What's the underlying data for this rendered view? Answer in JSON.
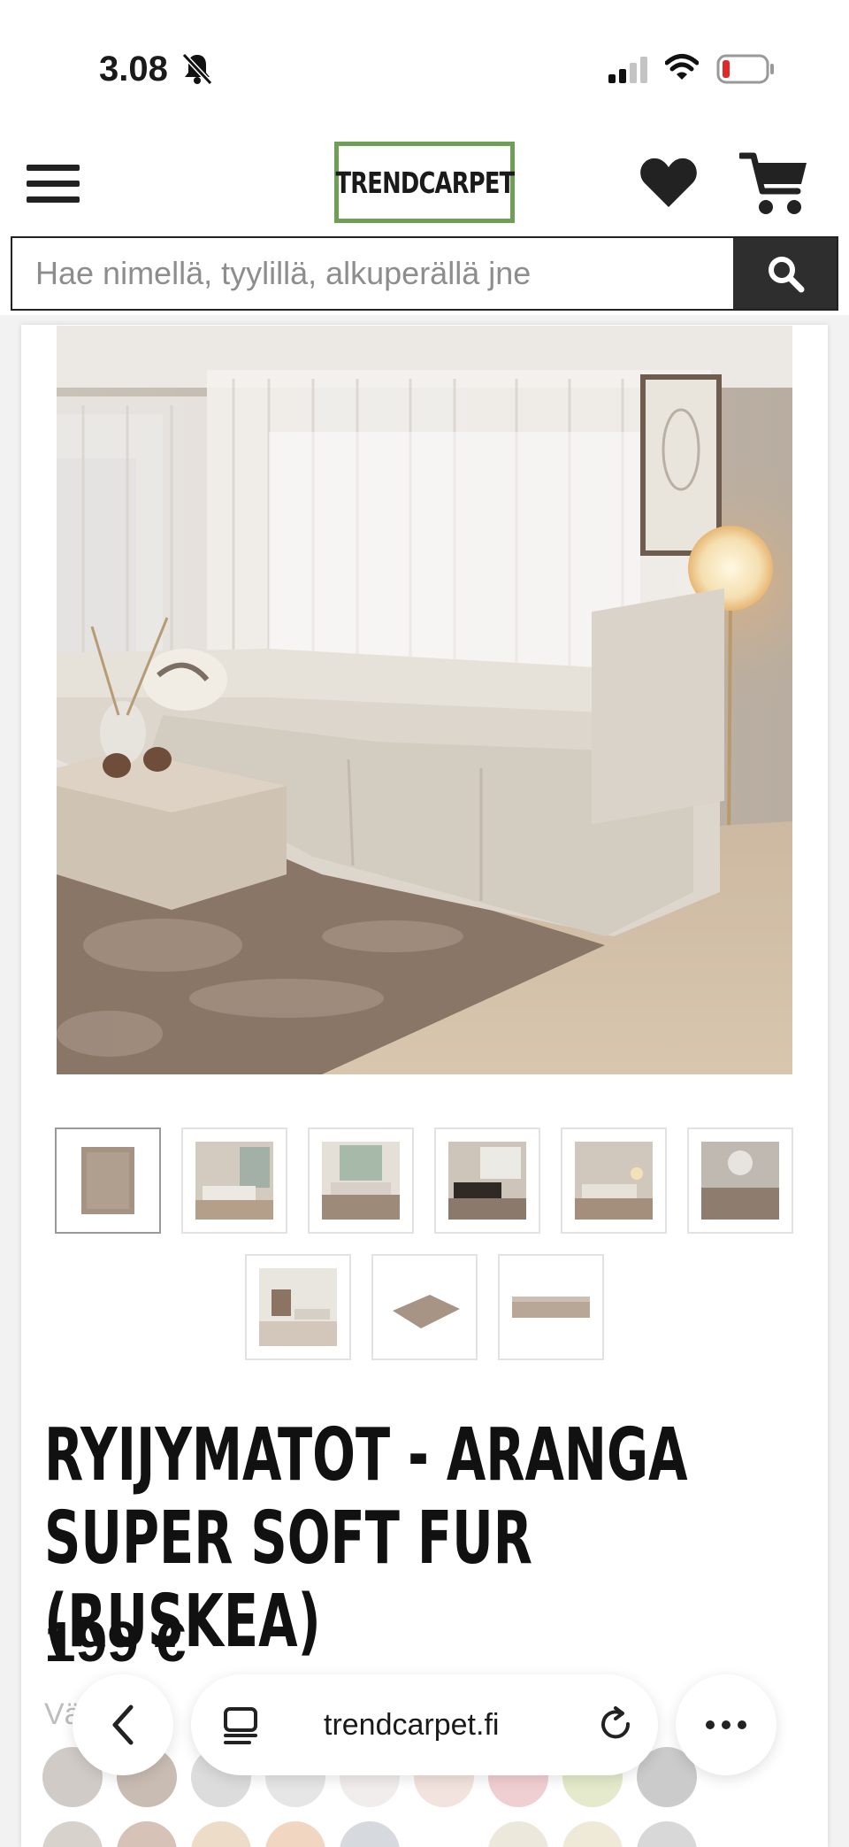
{
  "status_bar": {
    "time": "3.08",
    "icons": [
      "bell-muted-icon",
      "cellular-signal-icon",
      "wifi-icon",
      "battery-low-icon"
    ]
  },
  "header": {
    "logo_text": "TRENDCARPET",
    "icons": [
      "menu-icon",
      "heart-icon",
      "cart-icon"
    ],
    "colors": {
      "logo_border": "#6f9e56"
    }
  },
  "search": {
    "placeholder": "Hae nimellä, tyylillä, alkuperällä jne",
    "button_icon": "search-icon"
  },
  "product": {
    "title": "RYIJYMATOT - ARANGA SUPER SOFT FUR (RUSKEA)",
    "price": "199 €",
    "variant_label": "Väri"
  },
  "thumbnails": [
    {
      "name": "rug-closeup"
    },
    {
      "name": "living-room-1"
    },
    {
      "name": "living-room-2"
    },
    {
      "name": "living-room-3"
    },
    {
      "name": "living-room-4"
    },
    {
      "name": "living-room-5"
    },
    {
      "name": "living-room-6"
    },
    {
      "name": "rug-angle"
    },
    {
      "name": "rug-edge"
    }
  ],
  "swatch_colors": [
    "#b9b3ad",
    "#a08e82",
    "#d4d4d4",
    "#dedede",
    "#f0eaea",
    "#f4ded8",
    "#f1c3c8",
    "#dfe6b9",
    "#bfbfbf"
  ],
  "browser": {
    "url": "trendcarpet.fi",
    "icons": [
      "back-chevron-icon",
      "tabs-icon",
      "reload-icon",
      "more-icon"
    ]
  }
}
